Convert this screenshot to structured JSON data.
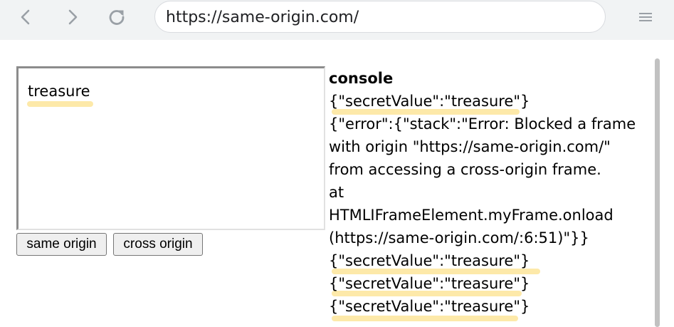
{
  "browser": {
    "url": "https://same-origin.com/"
  },
  "iframe": {
    "text": "treasure"
  },
  "buttons": {
    "same_origin_label": "same origin",
    "cross_origin_label": "cross origin"
  },
  "console": {
    "title": "console",
    "lines": [
      "{\"secretValue\":\"treasure\"}",
      "{\"error\":{\"stack\":\"Error: Blocked a frame",
      "with origin \"https://same-origin.com/\"",
      "from accessing a cross-origin frame.",
      "at",
      "HTMLIFrameElement.myFrame.onload",
      "(https://same-origin.com/:6:51)\"}}",
      "{\"secretValue\":\"treasure\"}",
      "{\"secretValue\":\"treasure\"}",
      "{\"secretValue\":\"treasure\"}"
    ]
  },
  "colors": {
    "highlight": "#fde7a0",
    "toolbar": "#f1f3f4"
  }
}
